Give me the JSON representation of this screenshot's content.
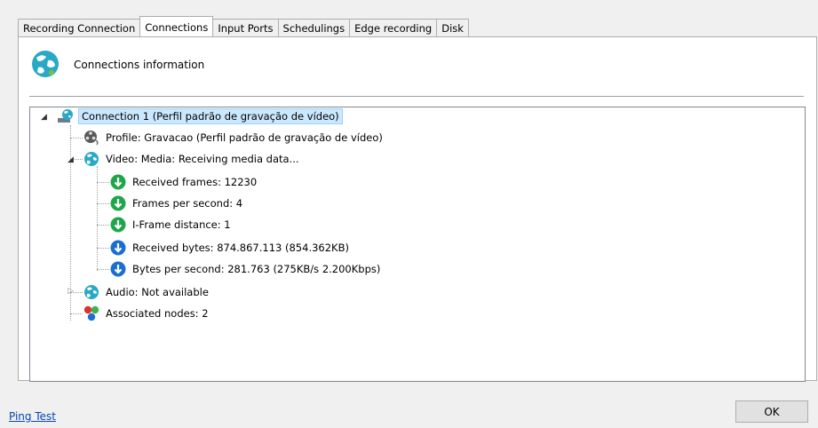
{
  "tabs": [
    {
      "label": "Recording Connection"
    },
    {
      "label": "Connections"
    },
    {
      "label": "Input Ports"
    },
    {
      "label": "Schedulings"
    },
    {
      "label": "Edge recording"
    },
    {
      "label": "Disk"
    }
  ],
  "active_tab": "Connections",
  "header": {
    "title": "Connections information",
    "icon": "globe-network-icon"
  },
  "tree": {
    "root": {
      "label": "Connection 1 (Perfil padrão de gravação de vídeo)",
      "icon": "connection-globe-icon",
      "expanded": true
    },
    "profile": {
      "label": "Profile: Gravacao (Perfil padrão de gravação de vídeo)",
      "icon": "film-reel-icon"
    },
    "video": {
      "label": "Video: Media: Receiving media data...",
      "icon": "globe-network-icon",
      "expanded": true
    },
    "video_items": [
      {
        "label": "Received frames: 12230",
        "icon": "green-down-arrow-icon"
      },
      {
        "label": "Frames per second: 4",
        "icon": "green-down-arrow-icon"
      },
      {
        "label": "I-Frame distance: 1",
        "icon": "green-down-arrow-icon"
      },
      {
        "label": "Received bytes: 874.867.113 (854.362KB)",
        "icon": "blue-down-arrow-icon"
      },
      {
        "label": "Bytes per second: 281.763 (275KB/s 2.200Kbps)",
        "icon": "blue-down-arrow-icon"
      }
    ],
    "audio": {
      "label": "Audio: Not available",
      "icon": "globe-network-icon",
      "expanded": false
    },
    "nodes": {
      "label": "Associated nodes: 2",
      "icon": "colored-dots-icon"
    }
  },
  "footer": {
    "ping_label": "Ping Test",
    "ok_label": "OK"
  },
  "colors": {
    "green": "#1ea64b",
    "blue": "#1a6fd1",
    "teal": "#2aa9c6",
    "selection": "#cce8ff"
  }
}
